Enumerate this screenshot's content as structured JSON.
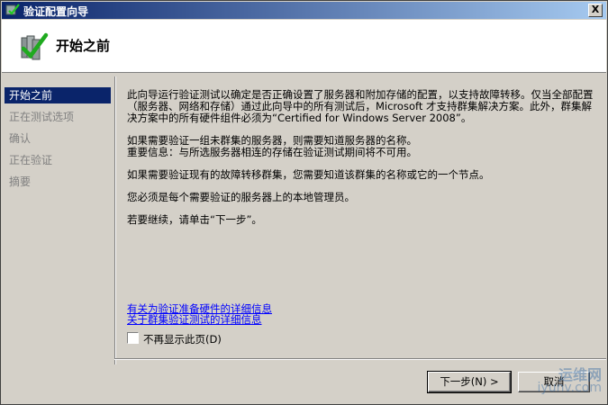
{
  "window": {
    "title": "验证配置向导",
    "close_label": "X"
  },
  "header": {
    "title": "开始之前",
    "icon": "cluster-check-icon"
  },
  "sidebar": {
    "items": [
      {
        "label": "开始之前",
        "active": true
      },
      {
        "label": "正在测试选项",
        "active": false
      },
      {
        "label": "确认",
        "active": false
      },
      {
        "label": "正在验证",
        "active": false
      },
      {
        "label": "摘要",
        "active": false
      }
    ]
  },
  "content": {
    "para1": "此向导运行验证测试以确定是否正确设置了服务器和附加存储的配置，以支持故障转移。仅当全部配置（服务器、网络和存储）通过此向导中的所有测试后，Microsoft 才支持群集解决方案。此外，群集解决方案中的所有硬件组件必须为“Certified for Windows Server 2008”。",
    "para2a": "如果需要验证一组未群集的服务器，则需要知道服务器的名称。",
    "para2b": "重要信息：与所选服务器相连的存储在验证测试期间将不可用。",
    "para3": "如果需要验证现有的故障转移群集，您需要知道该群集的名称或它的一个节点。",
    "para4": "您必须是每个需要验证的服务器上的本地管理员。",
    "para5": "若要继续，请单击“下一步”。"
  },
  "links": {
    "link1": "有关为验证准备硬件的详细信息",
    "link2": "关于群集验证测试的详细信息"
  },
  "checkbox": {
    "label": "不再显示此页(D)",
    "checked": false
  },
  "buttons": {
    "next": "下一步(N) >",
    "cancel": "取消"
  },
  "watermark": {
    "line1": "运维网",
    "line2": "iyunv.com"
  }
}
